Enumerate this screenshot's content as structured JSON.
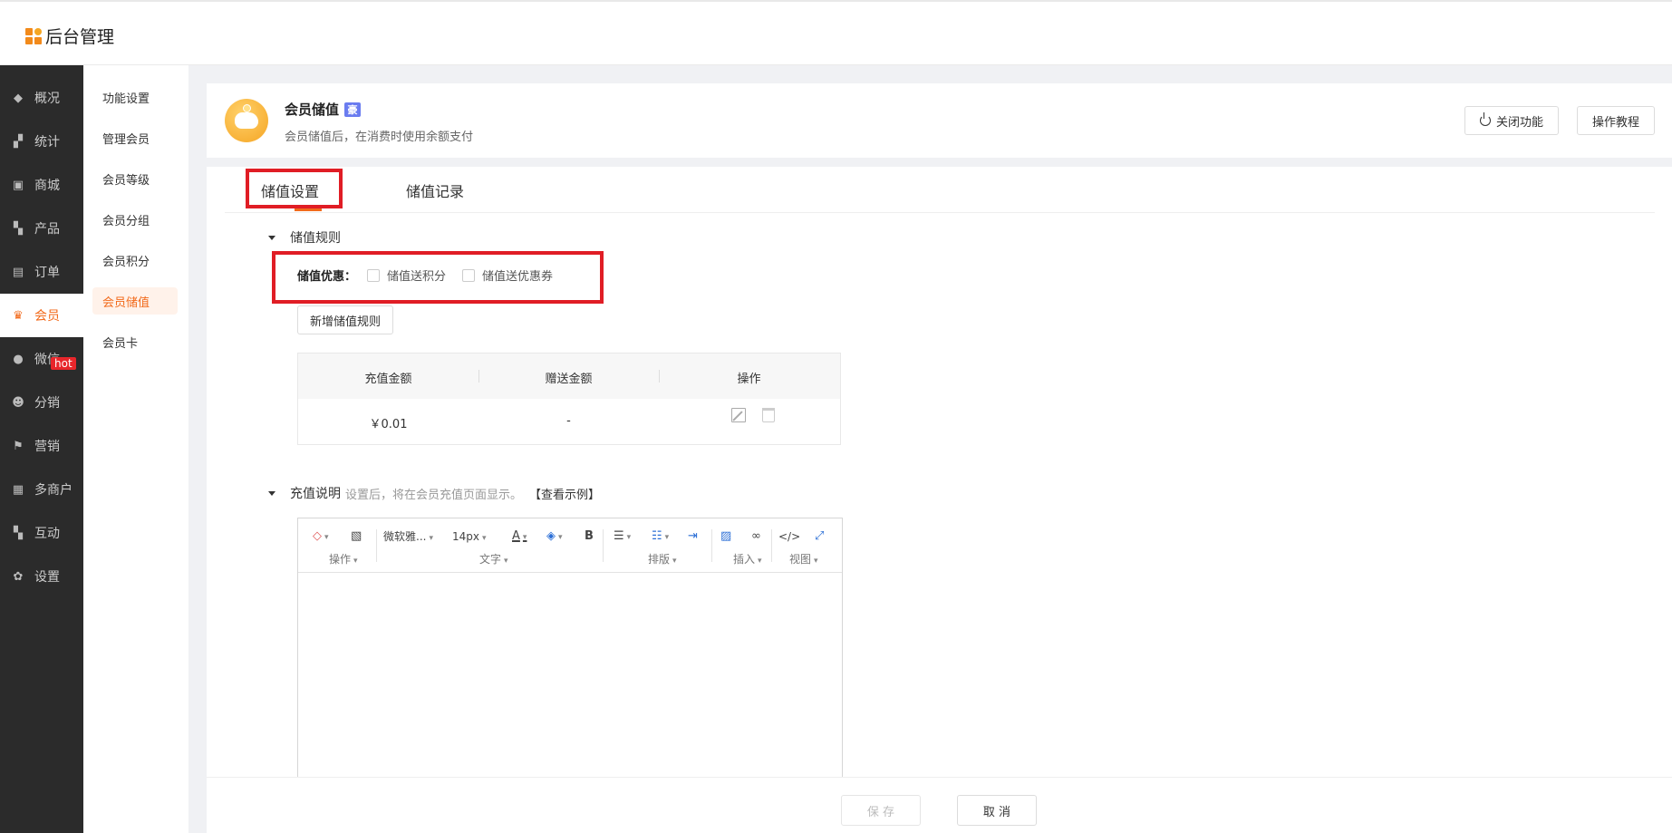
{
  "brand": {
    "name": "后台管理"
  },
  "nav": {
    "items": [
      {
        "label": "概况",
        "icon": "layers-icon"
      },
      {
        "label": "统计",
        "icon": "chart-icon"
      },
      {
        "label": "商城",
        "icon": "shop-icon"
      },
      {
        "label": "产品",
        "icon": "grid-icon"
      },
      {
        "label": "订单",
        "icon": "clipboard-icon"
      },
      {
        "label": "会员",
        "icon": "crown-icon"
      },
      {
        "label": "微信",
        "icon": "wechat-icon"
      },
      {
        "label": "分销",
        "icon": "users-icon"
      },
      {
        "label": "营销",
        "icon": "flag-icon"
      },
      {
        "label": "多商户",
        "icon": "store-icon"
      },
      {
        "label": "互动",
        "icon": "apps-icon"
      },
      {
        "label": "设置",
        "icon": "gear-icon"
      }
    ],
    "hot_badge": "hot"
  },
  "subnav": {
    "items": [
      "功能设置",
      "管理会员",
      "会员等级",
      "会员分组",
      "会员积分",
      "会员储值",
      "会员卡"
    ]
  },
  "header": {
    "title": "会员储值",
    "vip_badge": "豪",
    "description": "会员储值后，在消费时使用余额支付",
    "close_function_label": "关闭功能",
    "tutorial_label": "操作教程"
  },
  "tabs": [
    "储值设置",
    "储值记录"
  ],
  "rules_section": {
    "title": "储值规则",
    "promo_label": "储值优惠：",
    "checkbox_points": "储值送积分",
    "checkbox_coupon": "储值送优惠券",
    "new_rule_label": "新增储值规则"
  },
  "table": {
    "columns": [
      "充值金额",
      "赠送金额",
      "操作"
    ],
    "rows": [
      {
        "amount": "￥0.01",
        "gift": "-"
      }
    ]
  },
  "desc_section": {
    "title": "充值说明",
    "hint": "设置后，将在会员充值页面显示。",
    "link": "【查看示例】"
  },
  "editor": {
    "font_name": "微软雅...",
    "font_size": "14px",
    "group_caption_op": "操作",
    "group_caption_text": "文字",
    "group_caption_layout": "排版",
    "group_caption_insert": "插入",
    "group_caption_view": "视图"
  },
  "footer": {
    "save_label": "保 存",
    "cancel_label": "取 消"
  },
  "colors": {
    "accent": "#f26a1b",
    "highlight_box": "#e01d25",
    "nav_bg": "#2b2b2b",
    "vip_badge": "#6a7cf0"
  }
}
